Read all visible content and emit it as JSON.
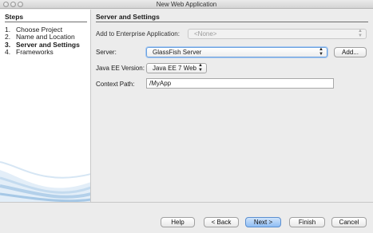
{
  "window": {
    "title": "New Web Application"
  },
  "steps": {
    "heading": "Steps",
    "items": [
      {
        "num": "1.",
        "label": "Choose Project"
      },
      {
        "num": "2.",
        "label": "Name and Location"
      },
      {
        "num": "3.",
        "label": "Server and Settings",
        "active": true
      },
      {
        "num": "4.",
        "label": "Frameworks"
      }
    ]
  },
  "panel": {
    "title": "Server and Settings",
    "enterprise": {
      "label": "Add to Enterprise Application:",
      "value": "<None>"
    },
    "server": {
      "label": "Server:",
      "value": "GlassFish Server",
      "add_label": "Add..."
    },
    "javaee": {
      "label": "Java EE Version:",
      "value": "Java EE 7 Web"
    },
    "context": {
      "label": "Context Path:",
      "value": "/MyApp"
    }
  },
  "buttons": {
    "help": "Help",
    "back": "< Back",
    "next": "Next >",
    "finish": "Finish",
    "cancel": "Cancel"
  },
  "colors": {
    "default_button": "#8fbdf3",
    "focus_ring": "#6aa1e0"
  }
}
